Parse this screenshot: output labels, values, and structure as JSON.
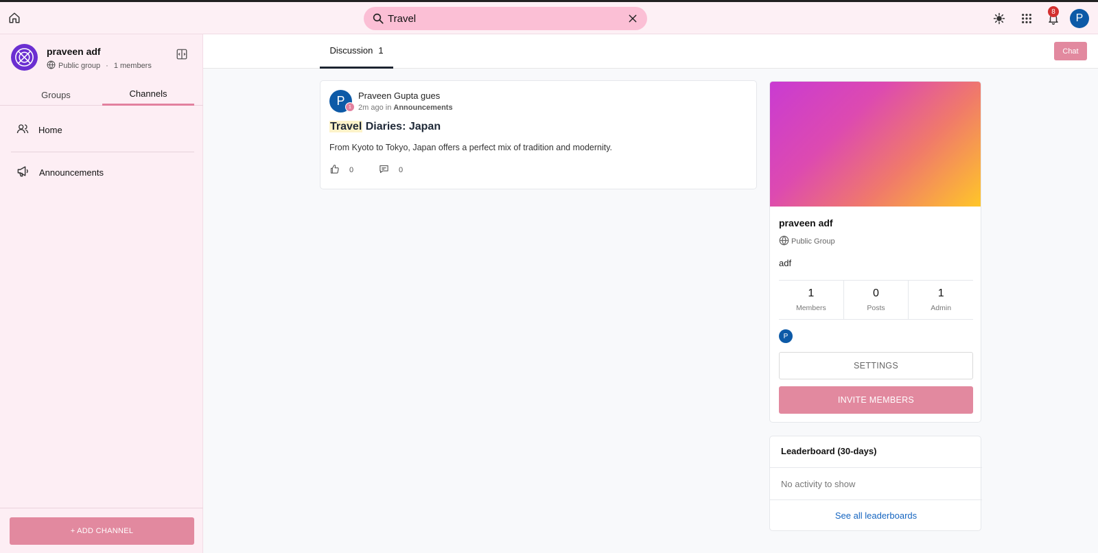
{
  "topbar": {
    "search_value": "Travel",
    "notification_count": "8",
    "user_initial": "P"
  },
  "sidebar": {
    "group_name": "praveen adf",
    "group_type": "Public group",
    "separator": "·",
    "member_count": "1 members",
    "tabs": [
      {
        "label": "Groups"
      },
      {
        "label": "Channels"
      }
    ],
    "items": [
      {
        "label": "Home"
      },
      {
        "label": "Announcements"
      }
    ],
    "add_channel_label": "+ ADD CHANNEL"
  },
  "main": {
    "tab_label": "Discussion",
    "tab_count": "1",
    "chat_label": "Chat"
  },
  "post": {
    "avatar_initial": "P",
    "shield_label": "1",
    "author": "Praveen Gupta gues",
    "time": "2m ago",
    "in_word": "in",
    "channel": "Announcements",
    "title_highlight": "Travel",
    "title_rest": " Diaries: Japan",
    "body": "From Kyoto to Tokyo, Japan offers a perfect mix of tradition and modernity.",
    "likes": "0",
    "comments": "0"
  },
  "group_card": {
    "name": "praveen adf",
    "type": "Public Group",
    "description": "adf",
    "stats": [
      {
        "num": "1",
        "label": "Members"
      },
      {
        "num": "0",
        "label": "Posts"
      },
      {
        "num": "1",
        "label": "Admin"
      }
    ],
    "member_initial": "P",
    "settings_label": "SETTINGS",
    "invite_label": "INVITE MEMBERS"
  },
  "leaderboard": {
    "title": "Leaderboard (30-days)",
    "empty_text": "No activity to show",
    "link_label": "See all leaderboards"
  },
  "colors": {
    "accent_pink": "#e2899f",
    "search_bg": "#fbbfd5",
    "avatar_blue": "#0d5aa7",
    "badge_red": "#d32f2f",
    "link_blue": "#1565c0"
  }
}
